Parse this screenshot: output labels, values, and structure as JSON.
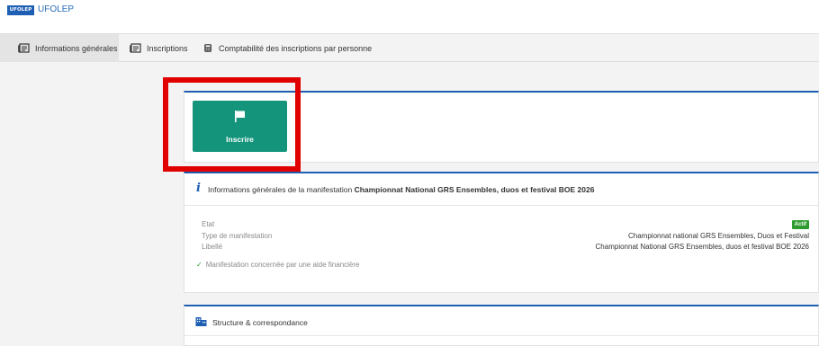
{
  "brand": {
    "logo_text": "UFOLEP",
    "name": "UFOLEP"
  },
  "tabs": [
    {
      "label": "Informations générales",
      "icon": "newspaper-icon",
      "active": true
    },
    {
      "label": "Inscriptions",
      "icon": "newspaper-icon",
      "active": false
    },
    {
      "label": "Comptabilité des inscriptions par personne",
      "icon": "calculator-icon",
      "active": false
    }
  ],
  "action": {
    "label": "Inscrire",
    "icon": "flag-icon"
  },
  "info": {
    "title_prefix": "Informations générales de la manifestation",
    "title_event": "Championnat National GRS Ensembles, duos et festival BOE 2026",
    "fields": [
      {
        "label": "Etat",
        "value": "Actif"
      },
      {
        "label": "Type de manifestation",
        "value": "Championnat national GRS Ensembles, Duos et Festival"
      },
      {
        "label": "Libellé",
        "value": "Championnat National GRS Ensembles, duos et festival BOE 2026"
      }
    ],
    "aid_text": "Manifestation concernée par une aide financière"
  },
  "structure": {
    "title": "Structure & correspondance",
    "icon": "building-icon"
  },
  "colors": {
    "accent_blue": "#1e5fb3",
    "primary_green": "#13947b",
    "status_green": "#2e9b2e",
    "highlight_red": "#e00000"
  }
}
